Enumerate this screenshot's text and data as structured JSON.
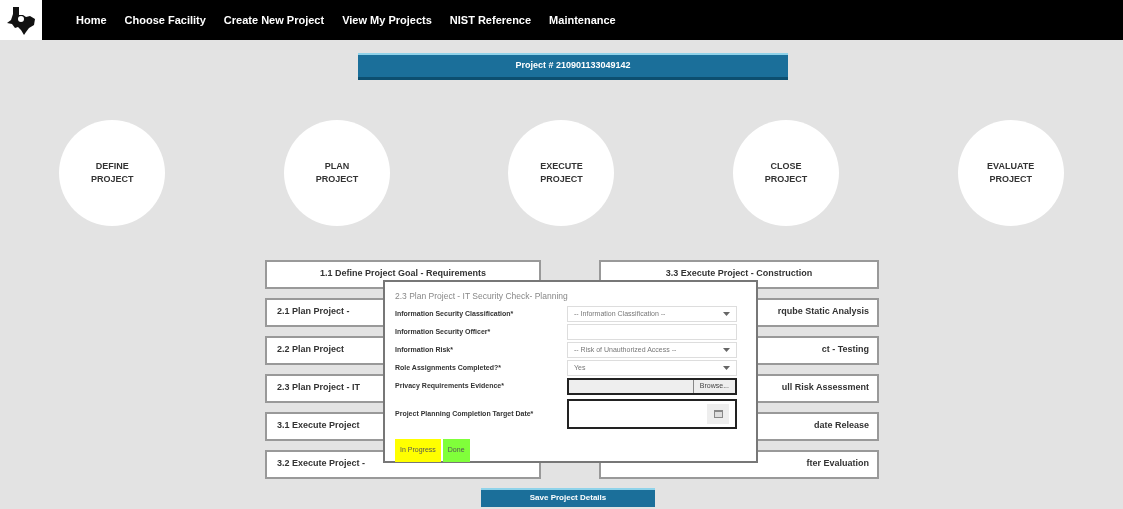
{
  "nav": {
    "items": [
      "Home",
      "Choose Facility",
      "Create New Project",
      "View My Projects",
      "NIST Reference",
      "Maintenance"
    ]
  },
  "project_header": "Project # 210901133049142",
  "phases": [
    "DEFINE PROJECT",
    "PLAN PROJECT",
    "EXECUTE PROJECT",
    "CLOSE PROJECT",
    "EVALUATE PROJECT"
  ],
  "tasks_left": [
    "1.1 Define Project Goal - Requirements",
    "2.1 Plan Project -",
    "2.2 Plan Project",
    "2.3 Plan Project - IT",
    "3.1 Execute Project",
    "3.2 Execute Project -"
  ],
  "tasks_right": [
    "3.3 Execute Project - Construction",
    "rqube Static Analysis",
    "ct - Testing",
    "ull Risk Assessment",
    "date Release",
    "fter Evaluation"
  ],
  "modal": {
    "title": "2.3 Plan Project - IT Security Check- Planning",
    "fields": [
      {
        "kind": "select",
        "label": "Information Security Classification*",
        "value": "-- Information Classification --"
      },
      {
        "kind": "text",
        "label": "Information Security Officer*"
      },
      {
        "kind": "select",
        "label": "Information Risk*",
        "value": "-- Risk of Unauthorized Access --"
      },
      {
        "kind": "select",
        "label": "Role Assignments Completed?*",
        "value": "Yes"
      },
      {
        "kind": "file",
        "label": "Privacy Requirements Evidence*",
        "button": "Browse..."
      },
      {
        "kind": "date",
        "label": "Project Planning Completion Target Date*"
      }
    ],
    "status_buttons": [
      {
        "label": "In Progress",
        "color": "#ffff00"
      },
      {
        "label": "Done",
        "color": "#80ff3a"
      }
    ]
  },
  "save_button": "Save Project Details"
}
